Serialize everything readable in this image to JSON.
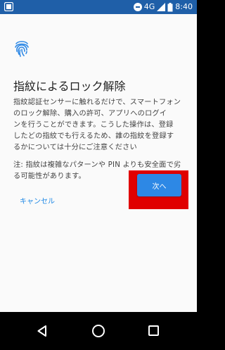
{
  "status_bar": {
    "network": "4G",
    "time": "8:40",
    "icons": [
      "app-icon",
      "do-not-disturb-icon",
      "signal-icon",
      "battery-icon"
    ]
  },
  "dialog": {
    "icon": "fingerprint-icon",
    "title": "指紋によるロック解除",
    "description_lines": [
      "指紋認証センサーに触れるだけで、スマートフォン",
      "のロック解除、購入の許可、アプリへのログイ",
      "ンを行うことができます。こうした操作は、登録",
      "したどの指紋でも行えるため、誰の指紋を登録す",
      "るかについては十分にご注意ください"
    ],
    "note_lines": [
      "注: 指紋は複雑なパターンや PIN よりも安全面で劣",
      "る可能性があります。"
    ],
    "cancel_label": "キャンセル",
    "next_label": "次へ"
  },
  "colors": {
    "status_bar": "#1f5fa8",
    "accent": "#2d88e5",
    "highlight": "#e00000"
  },
  "nav_bar": {
    "icons": [
      "back-icon",
      "home-icon",
      "recent-apps-icon"
    ]
  }
}
